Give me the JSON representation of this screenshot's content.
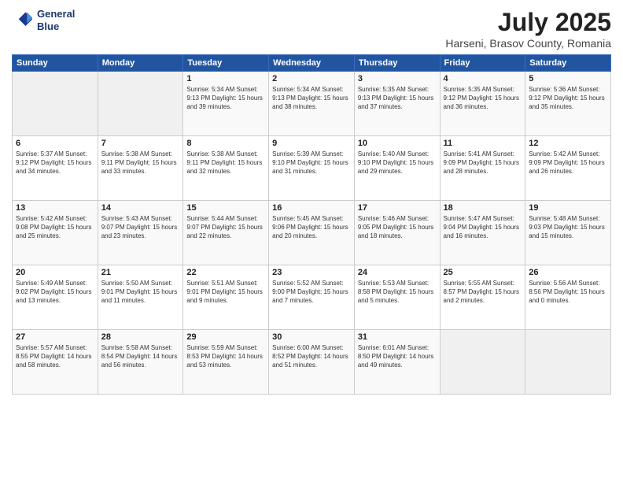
{
  "header": {
    "logo_line1": "General",
    "logo_line2": "Blue",
    "title": "July 2025",
    "subtitle": "Harseni, Brasov County, Romania"
  },
  "calendar": {
    "days_of_week": [
      "Sunday",
      "Monday",
      "Tuesday",
      "Wednesday",
      "Thursday",
      "Friday",
      "Saturday"
    ],
    "weeks": [
      [
        {
          "day": "",
          "detail": ""
        },
        {
          "day": "",
          "detail": ""
        },
        {
          "day": "1",
          "detail": "Sunrise: 5:34 AM\nSunset: 9:13 PM\nDaylight: 15 hours\nand 39 minutes."
        },
        {
          "day": "2",
          "detail": "Sunrise: 5:34 AM\nSunset: 9:13 PM\nDaylight: 15 hours\nand 38 minutes."
        },
        {
          "day": "3",
          "detail": "Sunrise: 5:35 AM\nSunset: 9:13 PM\nDaylight: 15 hours\nand 37 minutes."
        },
        {
          "day": "4",
          "detail": "Sunrise: 5:35 AM\nSunset: 9:12 PM\nDaylight: 15 hours\nand 36 minutes."
        },
        {
          "day": "5",
          "detail": "Sunrise: 5:36 AM\nSunset: 9:12 PM\nDaylight: 15 hours\nand 35 minutes."
        }
      ],
      [
        {
          "day": "6",
          "detail": "Sunrise: 5:37 AM\nSunset: 9:12 PM\nDaylight: 15 hours\nand 34 minutes."
        },
        {
          "day": "7",
          "detail": "Sunrise: 5:38 AM\nSunset: 9:11 PM\nDaylight: 15 hours\nand 33 minutes."
        },
        {
          "day": "8",
          "detail": "Sunrise: 5:38 AM\nSunset: 9:11 PM\nDaylight: 15 hours\nand 32 minutes."
        },
        {
          "day": "9",
          "detail": "Sunrise: 5:39 AM\nSunset: 9:10 PM\nDaylight: 15 hours\nand 31 minutes."
        },
        {
          "day": "10",
          "detail": "Sunrise: 5:40 AM\nSunset: 9:10 PM\nDaylight: 15 hours\nand 29 minutes."
        },
        {
          "day": "11",
          "detail": "Sunrise: 5:41 AM\nSunset: 9:09 PM\nDaylight: 15 hours\nand 28 minutes."
        },
        {
          "day": "12",
          "detail": "Sunrise: 5:42 AM\nSunset: 9:09 PM\nDaylight: 15 hours\nand 26 minutes."
        }
      ],
      [
        {
          "day": "13",
          "detail": "Sunrise: 5:42 AM\nSunset: 9:08 PM\nDaylight: 15 hours\nand 25 minutes."
        },
        {
          "day": "14",
          "detail": "Sunrise: 5:43 AM\nSunset: 9:07 PM\nDaylight: 15 hours\nand 23 minutes."
        },
        {
          "day": "15",
          "detail": "Sunrise: 5:44 AM\nSunset: 9:07 PM\nDaylight: 15 hours\nand 22 minutes."
        },
        {
          "day": "16",
          "detail": "Sunrise: 5:45 AM\nSunset: 9:06 PM\nDaylight: 15 hours\nand 20 minutes."
        },
        {
          "day": "17",
          "detail": "Sunrise: 5:46 AM\nSunset: 9:05 PM\nDaylight: 15 hours\nand 18 minutes."
        },
        {
          "day": "18",
          "detail": "Sunrise: 5:47 AM\nSunset: 9:04 PM\nDaylight: 15 hours\nand 16 minutes."
        },
        {
          "day": "19",
          "detail": "Sunrise: 5:48 AM\nSunset: 9:03 PM\nDaylight: 15 hours\nand 15 minutes."
        }
      ],
      [
        {
          "day": "20",
          "detail": "Sunrise: 5:49 AM\nSunset: 9:02 PM\nDaylight: 15 hours\nand 13 minutes."
        },
        {
          "day": "21",
          "detail": "Sunrise: 5:50 AM\nSunset: 9:01 PM\nDaylight: 15 hours\nand 11 minutes."
        },
        {
          "day": "22",
          "detail": "Sunrise: 5:51 AM\nSunset: 9:01 PM\nDaylight: 15 hours\nand 9 minutes."
        },
        {
          "day": "23",
          "detail": "Sunrise: 5:52 AM\nSunset: 9:00 PM\nDaylight: 15 hours\nand 7 minutes."
        },
        {
          "day": "24",
          "detail": "Sunrise: 5:53 AM\nSunset: 8:58 PM\nDaylight: 15 hours\nand 5 minutes."
        },
        {
          "day": "25",
          "detail": "Sunrise: 5:55 AM\nSunset: 8:57 PM\nDaylight: 15 hours\nand 2 minutes."
        },
        {
          "day": "26",
          "detail": "Sunrise: 5:56 AM\nSunset: 8:56 PM\nDaylight: 15 hours\nand 0 minutes."
        }
      ],
      [
        {
          "day": "27",
          "detail": "Sunrise: 5:57 AM\nSunset: 8:55 PM\nDaylight: 14 hours\nand 58 minutes."
        },
        {
          "day": "28",
          "detail": "Sunrise: 5:58 AM\nSunset: 8:54 PM\nDaylight: 14 hours\nand 56 minutes."
        },
        {
          "day": "29",
          "detail": "Sunrise: 5:59 AM\nSunset: 8:53 PM\nDaylight: 14 hours\nand 53 minutes."
        },
        {
          "day": "30",
          "detail": "Sunrise: 6:00 AM\nSunset: 8:52 PM\nDaylight: 14 hours\nand 51 minutes."
        },
        {
          "day": "31",
          "detail": "Sunrise: 6:01 AM\nSunset: 8:50 PM\nDaylight: 14 hours\nand 49 minutes."
        },
        {
          "day": "",
          "detail": ""
        },
        {
          "day": "",
          "detail": ""
        }
      ]
    ]
  }
}
